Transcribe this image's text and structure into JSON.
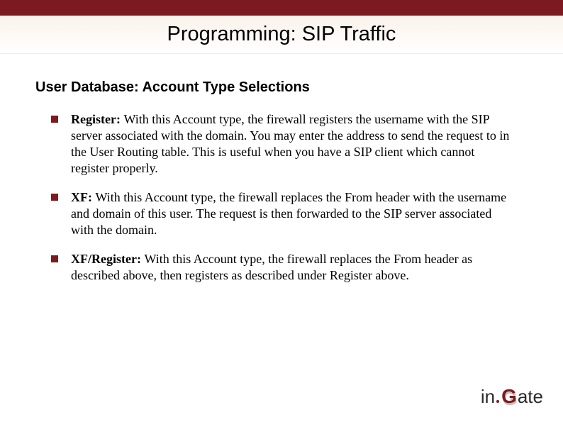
{
  "title": "Programming: SIP Traffic",
  "section_title": "User Database:  Account Type Selections",
  "bullets": [
    {
      "term": "Register:  ",
      "text": "With this Account type, the firewall registers the username with the SIP server associated with the domain. You may enter the address to send the request to in the User Routing table. This is useful when you have a SIP client which cannot register properly."
    },
    {
      "term": "XF: ",
      "text": "With this Account type, the firewall replaces the From header with the username and domain of this user. The request is then forwarded to the SIP server associated with the domain."
    },
    {
      "term": "XF/Register: ",
      "text": "With this Account type, the firewall replaces the From header as described above, then registers as described under Register above."
    }
  ],
  "logo": {
    "left": "in",
    "mid": "G",
    "right": "ate"
  }
}
